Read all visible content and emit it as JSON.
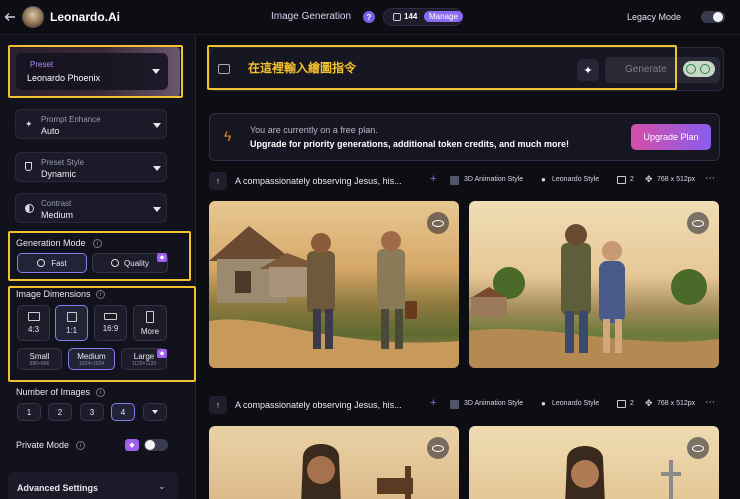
{
  "header": {
    "brand": "Leonardo.Ai",
    "page_title": "Image Generation",
    "token_count": "144",
    "manage_label": "Manage",
    "legacy_mode_label": "Legacy Mode"
  },
  "sidebar": {
    "preset": {
      "label": "Preset",
      "value": "Leonardo Phoenix"
    },
    "prompt_enhance": {
      "label": "Prompt Enhance",
      "value": "Auto"
    },
    "preset_style": {
      "label": "Preset Style",
      "value": "Dynamic"
    },
    "contrast": {
      "label": "Contrast",
      "value": "Medium"
    },
    "generation_mode": {
      "title": "Generation Mode",
      "fast": "Fast",
      "quality": "Quality"
    },
    "image_dimensions": {
      "title": "Image Dimensions",
      "ratios": [
        "4:3",
        "1:1",
        "16:9",
        "More"
      ],
      "sizes": [
        {
          "label": "Small",
          "dims": "896×896"
        },
        {
          "label": "Medium",
          "dims": "1024×1024"
        },
        {
          "label": "Large",
          "dims": "1120×1120"
        }
      ]
    },
    "number_of_images": {
      "title": "Number of Images",
      "options": [
        "1",
        "2",
        "3",
        "4"
      ],
      "selected": "4"
    },
    "private_mode": {
      "label": "Private Mode"
    },
    "advanced_settings": "Advanced Settings"
  },
  "prompt": {
    "text": "在這裡輸入繪圖指令",
    "generate_label": "Generate"
  },
  "banner": {
    "line1": "You are currently on a free plan.",
    "line2": "Upgrade for priority generations, additional token credits, and much more!",
    "upgrade_label": "Upgrade Plan"
  },
  "generations": [
    {
      "prompt": "A compassionately observing Jesus, his...",
      "model": "3D Animation Style",
      "style": "Leonardo Style",
      "count": "2",
      "size": "768 x 512px"
    },
    {
      "prompt": "A compassionately observing Jesus, his...",
      "model": "3D Animation Style",
      "style": "Leonardo Style",
      "count": "2",
      "size": "768 x 512px"
    }
  ],
  "colors": {
    "accent_purple": "#8a6cf2",
    "highlight_yellow": "#f2c12e",
    "upgrade_pink": "#d44fa6"
  }
}
